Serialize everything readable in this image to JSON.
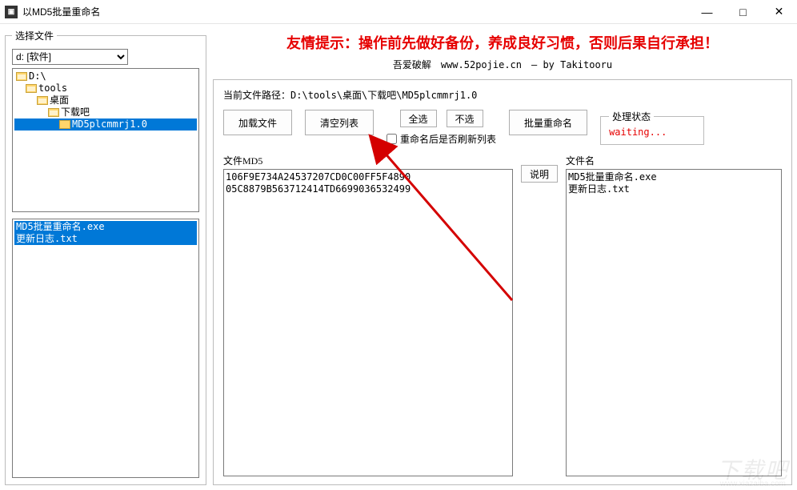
{
  "window": {
    "icon_text": "▣",
    "title": "以MD5批量重命名",
    "min": "—",
    "max": "□",
    "close": "✕"
  },
  "sidebar": {
    "legend": "选择文件",
    "drive_option": "d: [软件]",
    "tree": {
      "root": "D:\\",
      "n1": "tools",
      "n2": "桌面",
      "n3": "下载吧",
      "n4": "MD5plcmmrj1.0"
    },
    "files": [
      "MD5批量重命名.exe",
      "更新日志.txt"
    ]
  },
  "warning": "友情提示：操作前先做好备份，养成良好习惯，否则后果自行承担！",
  "credits": "吾爱破解　www.52pojie.cn　– by Takitooru",
  "path_label": "当前文件路径：",
  "path_value": "D:\\tools\\桌面\\下载吧\\MD5plcmmrj1.0",
  "buttons": {
    "load": "加载文件",
    "clear": "清空列表",
    "sel_all": "全选",
    "sel_none": "不选",
    "batch": "批量重命名",
    "explain": "说明"
  },
  "refresh_label": "重命名后是否刷新列表",
  "status": {
    "legend": "处理状态",
    "text": "waiting..."
  },
  "md5_label": "文件MD5",
  "md5_list": [
    "106F9E734A24537207CD0C00FF5F4890",
    "05C8879B563712414TD6699036532499"
  ],
  "name_label": "文件名",
  "name_list": [
    "MD5批量重命名.exe",
    "更新日志.txt"
  ],
  "watermark": "下载吧",
  "watermark_sub": "www.xiazaiba.com"
}
